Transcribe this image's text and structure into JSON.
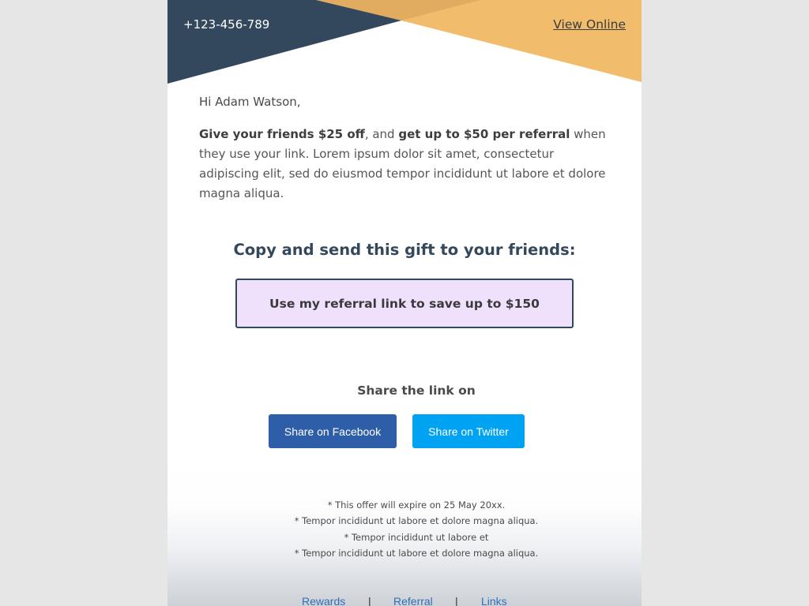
{
  "header": {
    "phone": "+123-456-789",
    "view_online": "View Online",
    "colors": {
      "navy": "#34485d",
      "gold": "#f1bd6c",
      "gold_dark": "#e1ac60"
    }
  },
  "body": {
    "greeting": "Hi Adam Watson,",
    "intro": {
      "bold_1": "Give your friends $25 off",
      "text_1": ", and ",
      "bold_2": "get up to $50 per referral",
      "text_2": " when they use your link. Lorem ipsum dolor sit amet, consectetur adipiscing elit, sed do eiusmod tempor incididunt ut labore et dolore magna aliqua."
    },
    "gift_heading": "Copy and send this gift to your friends:",
    "referral_link_label": "Use my referral link to save up to $150"
  },
  "share": {
    "label": "Share the link on",
    "facebook_label": "Share on Facebook",
    "twitter_label": "Share on Twitter",
    "colors": {
      "facebook": "#2f5ea8",
      "twitter": "#00a2f2"
    }
  },
  "footer": {
    "notes": [
      "* This offer will expire on 25 May 20xx.",
      "* Tempor incididunt ut labore et dolore magna aliqua.",
      "* Tempor incididunt ut labore et",
      "* Tempor incididunt ut labore et dolore magna aliqua."
    ],
    "links": [
      "Rewards",
      "Referral",
      "Links"
    ],
    "separator": "|"
  }
}
